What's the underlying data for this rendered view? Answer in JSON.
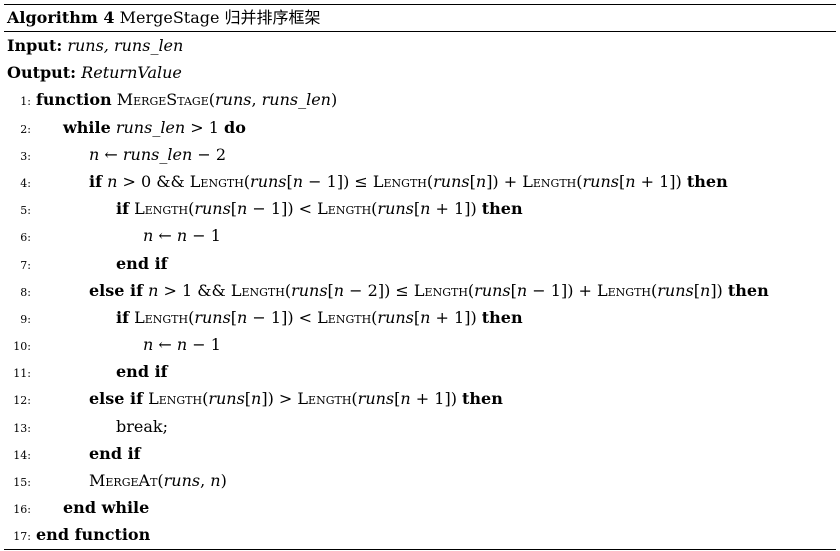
{
  "caption": {
    "label": "Algorithm 4",
    "title": "MergeStage 归并排序框架"
  },
  "io": {
    "input_label": "Input:",
    "input_value": "runs, runs_len",
    "output_label": "Output:",
    "output_value": "ReturnValue"
  },
  "lines": [
    {
      "num": "1:",
      "text": "function MergeStage(runs, runs_len)"
    },
    {
      "num": "2:",
      "text": "while runs_len > 1 do"
    },
    {
      "num": "3:",
      "text": "n ← runs_len − 2"
    },
    {
      "num": "4:",
      "text": "if n > 0 && Length(runs[n − 1]) ≤ Length(runs[n]) + Length(runs[n + 1]) then"
    },
    {
      "num": "5:",
      "text": "if Length(runs[n − 1]) < Length(runs[n + 1]) then"
    },
    {
      "num": "6:",
      "text": "n ← n − 1"
    },
    {
      "num": "7:",
      "text": "end if"
    },
    {
      "num": "8:",
      "text": "else if n > 1 && Length(runs[n − 2]) ≤ Length(runs[n − 1]) + Length(runs[n]) then"
    },
    {
      "num": "9:",
      "text": "if Length(runs[n − 1]) < Length(runs[n + 1]) then"
    },
    {
      "num": "10:",
      "text": "n ← n − 1"
    },
    {
      "num": "11:",
      "text": "end if"
    },
    {
      "num": "12:",
      "text": "else if Length(runs[n]) > Length(runs[n + 1]) then"
    },
    {
      "num": "13:",
      "text": "break;"
    },
    {
      "num": "14:",
      "text": "end if"
    },
    {
      "num": "15:",
      "text": "MergeAt(runs, n)"
    },
    {
      "num": "16:",
      "text": "end while"
    },
    {
      "num": "17:",
      "text": "end function"
    }
  ]
}
